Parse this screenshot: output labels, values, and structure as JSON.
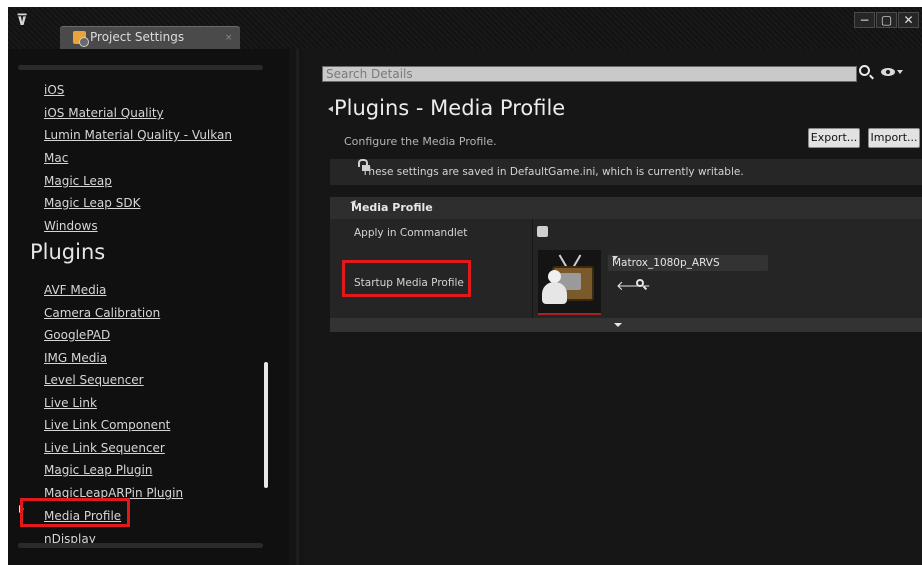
{
  "window": {
    "tab_title": "Project Settings",
    "tab_close": "×",
    "min_glyph": "−",
    "max_glyph": "▢",
    "close_glyph": "✕"
  },
  "sidebar": {
    "platform_items": [
      "iOS",
      "iOS Material Quality",
      "Lumin Material Quality - Vulkan",
      "Mac",
      "Magic Leap",
      "Magic Leap SDK",
      "Windows"
    ],
    "section_title": "Plugins",
    "plugin_items": [
      "AVF Media",
      "Camera Calibration",
      "GooglePAD",
      "IMG Media",
      "Level Sequencer",
      "Live Link",
      "Live Link Component",
      "Live Link Sequencer",
      "Magic Leap Plugin",
      "MagicLeapARPin Plugin",
      "Media Profile",
      "nDisplay"
    ],
    "selected_item": "Media Profile"
  },
  "search": {
    "placeholder": "Search Details"
  },
  "page": {
    "title": "Plugins - Media Profile",
    "description": "Configure the Media Profile.",
    "export_label": "Export...",
    "import_label": "Import...",
    "notice": "These settings are saved in DefaultGame.ini, which is currently writable."
  },
  "category": {
    "title": "Media Profile",
    "rows": [
      {
        "label": "Apply in Commandlet",
        "checked": false
      },
      {
        "label": "Startup Media Profile",
        "value": "Matrox_1080p_ARVS"
      }
    ]
  },
  "icons": [
    "ue-logo-icon",
    "settings-tab-icon",
    "search-icon",
    "eye-icon",
    "lock-icon",
    "media-profile-asset-icon",
    "back-arrow-icon",
    "browse-icon"
  ],
  "colors": {
    "highlight_box": "#e01a1a",
    "panel_bg": "#151515",
    "row_bg": "#252525"
  }
}
